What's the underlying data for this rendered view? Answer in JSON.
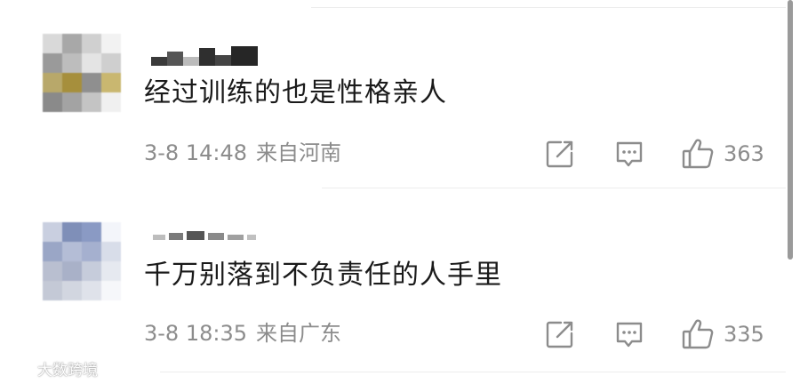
{
  "comments": [
    {
      "content": "经过训练的也是性格亲人",
      "date": "3-8 14:48",
      "location": "来自河南",
      "likes": "363"
    },
    {
      "content": "千万别落到不负责任的人手里",
      "date": "3-8 18:35",
      "location": "来自广东",
      "likes": "335"
    }
  ],
  "watermark": {
    "text": "大数跨境"
  },
  "icons": {
    "share": "share-icon",
    "reply": "comment-icon",
    "like": "thumbs-up-icon"
  },
  "colors": {
    "text": "#1a1a1a",
    "meta": "#8c8c8c",
    "icon": "#8c8c8c",
    "divider": "#ececec"
  }
}
